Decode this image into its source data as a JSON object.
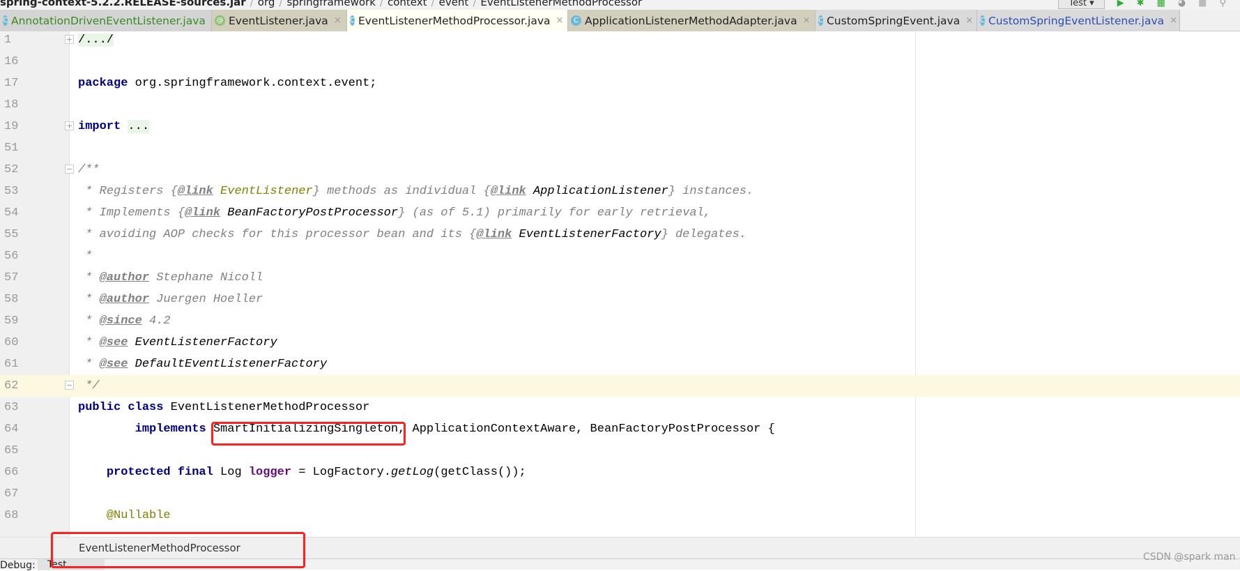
{
  "breadcrumb": [
    "spring-context-5.2.2.RELEASE-sources.jar",
    "org",
    "springframework",
    "context",
    "event",
    "EventListenerMethodProcessor"
  ],
  "toolbar": {
    "run_config": "Test ▾",
    "icons": [
      "vcs-update-icon",
      "run-icon",
      "debug-icon",
      "coverage-icon",
      "profile-icon",
      "stop-icon",
      "build-icon",
      "search-icon"
    ]
  },
  "tabs": [
    {
      "label": "AnnotationDrivenEventListener.java",
      "icon": "C"
    },
    {
      "label": "EventListener.java",
      "icon": "@"
    },
    {
      "label": "EventListenerMethodProcessor.java",
      "icon": "C",
      "active": true
    },
    {
      "label": "ApplicationListenerMethodAdapter.java",
      "icon": "C"
    },
    {
      "label": "CustomSpringEvent.java",
      "icon": "C"
    },
    {
      "label": "CustomSpringEventListener.java",
      "icon": "C"
    }
  ],
  "tab_close": "×",
  "lines": [
    {
      "n": "1",
      "fold": "+",
      "tokens": [
        {
          "t": "/.../",
          "k": "folded"
        }
      ]
    },
    {
      "n": "16",
      "tokens": []
    },
    {
      "n": "17",
      "tokens": [
        {
          "t": "package",
          "k": "kw"
        },
        {
          "t": " org.springframework.context.event;",
          "k": "pl"
        }
      ]
    },
    {
      "n": "18",
      "tokens": []
    },
    {
      "n": "19",
      "fold": "+",
      "tokens": [
        {
          "t": "import",
          "k": "kw"
        },
        {
          "t": " ",
          "k": "pl"
        },
        {
          "t": "...",
          "k": "folded"
        }
      ]
    },
    {
      "n": "51",
      "tokens": []
    },
    {
      "n": "52",
      "fold": "−",
      "tokens": [
        {
          "t": "/**",
          "k": "cm"
        }
      ]
    },
    {
      "n": "53",
      "tokens": [
        {
          "t": " * Registers {",
          "k": "cm"
        },
        {
          "t": "@link",
          "k": "tag"
        },
        {
          "t": " ",
          "k": "cm"
        },
        {
          "t": "EventListener",
          "k": "refa"
        },
        {
          "t": "} methods as individual {",
          "k": "cm"
        },
        {
          "t": "@link",
          "k": "tag"
        },
        {
          "t": " ",
          "k": "cm"
        },
        {
          "t": "ApplicationListener",
          "k": "ref"
        },
        {
          "t": "} instances.",
          "k": "cm"
        }
      ]
    },
    {
      "n": "54",
      "tokens": [
        {
          "t": " * Implements {",
          "k": "cm"
        },
        {
          "t": "@link",
          "k": "tag"
        },
        {
          "t": " ",
          "k": "cm"
        },
        {
          "t": "BeanFactoryPostProcessor",
          "k": "ref"
        },
        {
          "t": "} (as of 5.1) primarily for early retrieval,",
          "k": "cm"
        }
      ]
    },
    {
      "n": "55",
      "tokens": [
        {
          "t": " * avoiding AOP checks for this processor bean and its {",
          "k": "cm"
        },
        {
          "t": "@link",
          "k": "tag"
        },
        {
          "t": " ",
          "k": "cm"
        },
        {
          "t": "EventListenerFactory",
          "k": "ref"
        },
        {
          "t": "} delegates.",
          "k": "cm"
        }
      ]
    },
    {
      "n": "56",
      "tokens": [
        {
          "t": " *",
          "k": "cm"
        }
      ]
    },
    {
      "n": "57",
      "tokens": [
        {
          "t": " * ",
          "k": "cm"
        },
        {
          "t": "@author",
          "k": "tag"
        },
        {
          "t": " Stephane Nicoll",
          "k": "cm"
        }
      ]
    },
    {
      "n": "58",
      "tokens": [
        {
          "t": " * ",
          "k": "cm"
        },
        {
          "t": "@author",
          "k": "tag"
        },
        {
          "t": " Juergen Hoeller",
          "k": "cm"
        }
      ]
    },
    {
      "n": "59",
      "tokens": [
        {
          "t": " * ",
          "k": "cm"
        },
        {
          "t": "@since",
          "k": "tag"
        },
        {
          "t": " 4.2",
          "k": "cm"
        }
      ]
    },
    {
      "n": "60",
      "tokens": [
        {
          "t": " * ",
          "k": "cm"
        },
        {
          "t": "@see",
          "k": "tag"
        },
        {
          "t": " ",
          "k": "cm"
        },
        {
          "t": "EventListenerFactory",
          "k": "ref"
        }
      ]
    },
    {
      "n": "61",
      "tokens": [
        {
          "t": " * ",
          "k": "cm"
        },
        {
          "t": "@see",
          "k": "tag"
        },
        {
          "t": " ",
          "k": "cm"
        },
        {
          "t": "DefaultEventListenerFactory",
          "k": "ref"
        }
      ]
    },
    {
      "n": "62",
      "fold": "−",
      "current": true,
      "tokens": [
        {
          "t": " */",
          "k": "cm"
        }
      ]
    },
    {
      "n": "63",
      "tokens": [
        {
          "t": "public class",
          "k": "kw"
        },
        {
          "t": " EventListenerMethodProcessor",
          "k": "pl"
        }
      ]
    },
    {
      "n": "64",
      "tokens": [
        {
          "t": "        ",
          "k": "pl"
        },
        {
          "t": "implements",
          "k": "kw"
        },
        {
          "t": " SmartInitializingSingleton, ApplicationContextAware, BeanFactoryPostProcessor {",
          "k": "pl"
        }
      ]
    },
    {
      "n": "65",
      "tokens": []
    },
    {
      "n": "66",
      "tokens": [
        {
          "t": "    ",
          "k": "pl"
        },
        {
          "t": "protected final",
          "k": "kw"
        },
        {
          "t": " Log ",
          "k": "pl"
        },
        {
          "t": "logger",
          "k": "fld"
        },
        {
          "t": " = LogFactory.",
          "k": "pl"
        },
        {
          "t": "getLog",
          "k": "st"
        },
        {
          "t": "(getClass());",
          "k": "pl"
        }
      ]
    },
    {
      "n": "67",
      "tokens": []
    },
    {
      "n": "68",
      "tokens": [
        {
          "t": "    ",
          "k": "pl"
        },
        {
          "t": "@Nullable",
          "k": "ann"
        }
      ]
    }
  ],
  "status": {
    "breadcrumb": "EventListenerMethodProcessor"
  },
  "bottom": {
    "debug_label": "Debug:",
    "tab": "Test"
  },
  "watermark": "CSDN @spark man",
  "colors": {
    "highlight_box": "#ff2020",
    "keyword": "#000080",
    "comment": "#808080"
  }
}
